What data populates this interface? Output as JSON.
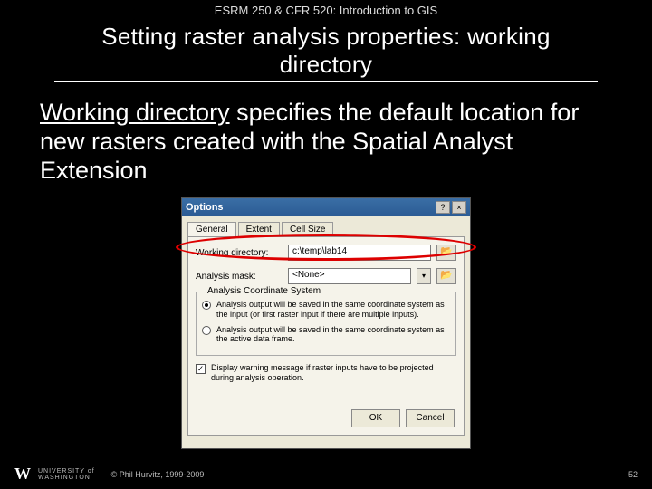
{
  "course_header": "ESRM 250 & CFR 520: Introduction to GIS",
  "title": "Setting raster analysis properties: working directory",
  "body": {
    "underlined": "Working directory",
    "rest": " specifies the default location for new rasters created with the Spatial Analyst Extension"
  },
  "dialog": {
    "title": "Options",
    "help_btn": "?",
    "close_btn": "×",
    "tabs": {
      "general": "General",
      "extent": "Extent",
      "cellsize": "Cell Size"
    },
    "working_dir_label": "Working directory:",
    "working_dir_value": "c:\\temp\\lab14",
    "browse_glyph": "📂",
    "mask_label": "Analysis mask:",
    "mask_value": "<None>",
    "dropdown_glyph": "▾",
    "group_title": "Analysis Coordinate System",
    "radio1": "Analysis output will be saved in the same coordinate system as the input (or first raster input if there are multiple inputs).",
    "radio2": "Analysis output will be saved in the same coordinate system as the active data frame.",
    "check_label": "Display warning message if raster inputs have to be projected during analysis operation.",
    "check_glyph": "✓",
    "ok": "OK",
    "cancel": "Cancel"
  },
  "footer": {
    "logo_w": "W",
    "uw_line1": "UNIVERSITY of",
    "uw_line2": "WASHINGTON",
    "copyright": "© Phil Hurvitz, 1999-2009",
    "page": "52"
  }
}
